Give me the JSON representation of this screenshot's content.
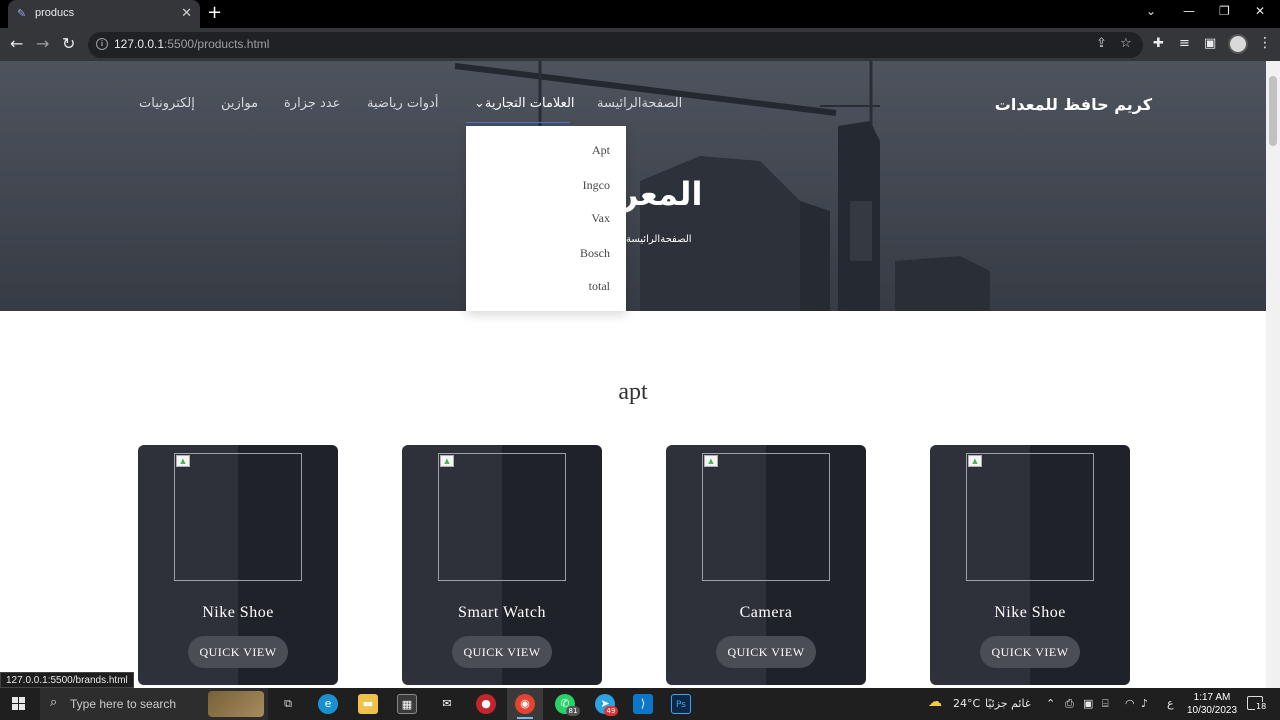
{
  "browser": {
    "tab_title": "producs",
    "new_tab": "+",
    "url_host": "127.0.0.1",
    "url_rest": ":5500/products.html",
    "status_url": "127.0.0.1:5500/brands.html"
  },
  "page": {
    "brand": "كريم حافظ للمعدات",
    "nav": {
      "home": "الصفحةالرائيسة",
      "brands": "العلامات التجارية",
      "sports": "أدوات رياضية",
      "hardware": "عدد جزارة",
      "scales": "موازين",
      "electronics": "إلكترونيات"
    },
    "dropdown": [
      "Apt",
      "Ingco",
      "Vax",
      "Bosch",
      "total"
    ],
    "hero_title": "المعر",
    "hero_crumb": "الصفحةالرائيسة",
    "section_title": "apt",
    "quick_view": "QUICK VIEW",
    "products": [
      "Nike Shoe",
      "Smart Watch",
      "Camera",
      "Nike Shoe"
    ]
  },
  "taskbar": {
    "search_placeholder": "Type here to search",
    "weather_temp": "24°C",
    "weather_text": "غائم جزئيًا",
    "lang": "ع",
    "time": "1:17 AM",
    "date": "10/30/2023",
    "whatsapp_badge": "81",
    "telegram_badge": "49",
    "notification_count": "18"
  },
  "colors": {
    "accent_underline": "#4a73d9",
    "card_dark": "#1f2229",
    "card_light": "#2e313a",
    "button": "#4a4d54"
  }
}
